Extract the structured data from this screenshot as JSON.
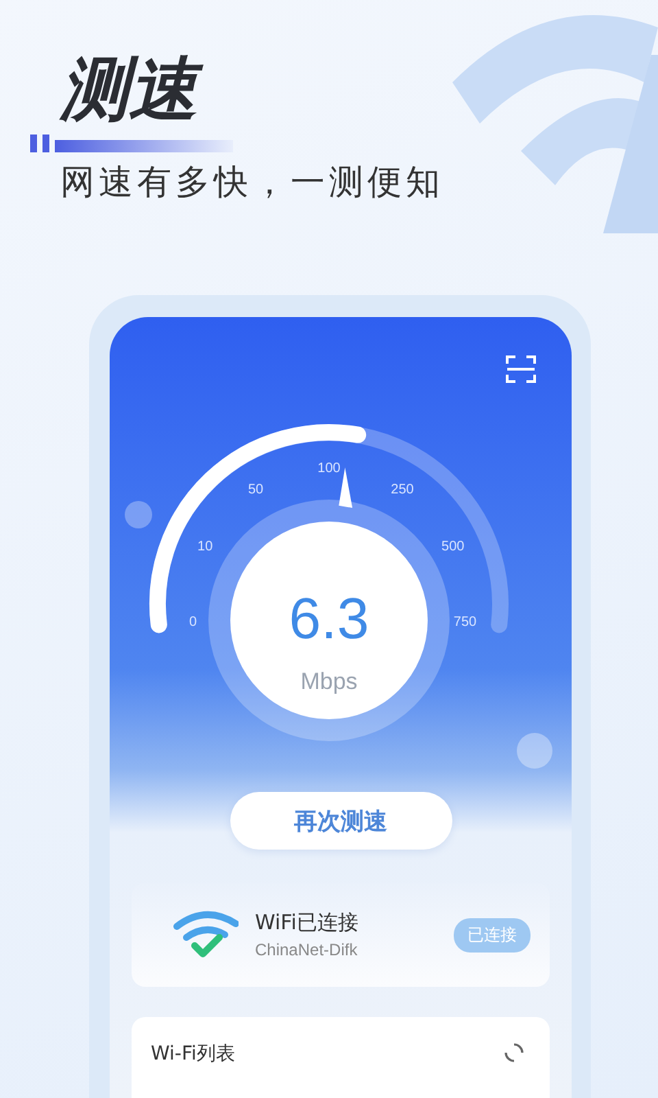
{
  "header": {
    "title": "测速",
    "subtitle": "网速有多快，一测便知"
  },
  "gauge": {
    "ticks": [
      "0",
      "10",
      "50",
      "100",
      "250",
      "500",
      "750"
    ],
    "level": 0.55,
    "value": "6.3",
    "unit": "Mbps"
  },
  "retest_button": "再次测速",
  "wifi_card": {
    "title": "WiFi已连接",
    "network": "ChinaNet-Difk",
    "status": "已连接"
  },
  "wifi_list": {
    "title": "Wi-Fi列表"
  }
}
